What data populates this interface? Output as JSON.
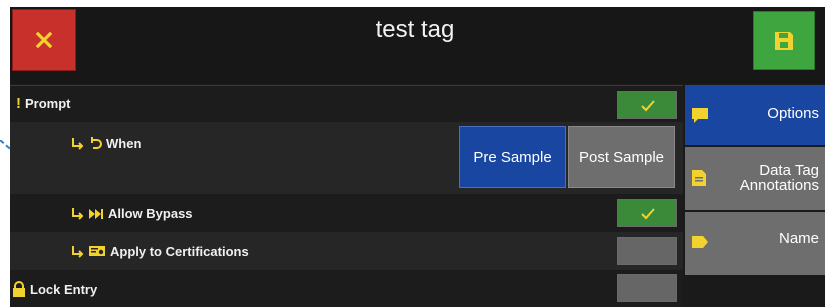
{
  "header": {
    "title": "test tag"
  },
  "rows": {
    "prompt_label": "Prompt",
    "when_label": "When",
    "allow_bypass_label": "Allow Bypass",
    "apply_cert_label": "Apply to Certifications",
    "lock_entry_label": "Lock Entry"
  },
  "when_options": {
    "pre": "Pre Sample",
    "post": "Post Sample",
    "selected": "Pre Sample"
  },
  "toggles": {
    "prompt": true,
    "allow_bypass": true,
    "apply_to_certifications": false,
    "lock_entry": false
  },
  "side_panel": {
    "options": "Options",
    "data_tag_line1": "Data Tag",
    "data_tag_line2": "Annotations",
    "name": "Name"
  },
  "colors": {
    "accent_yellow": "#f2d22e",
    "selected_blue": "#1846a0",
    "check_green": "#3a8a3a",
    "close_red": "#c8302c",
    "save_green": "#3fa63f"
  },
  "icons": [
    "close-icon",
    "save-icon",
    "exclamation-icon",
    "sub-arrow-icon",
    "undo-icon",
    "fast-forward-icon",
    "certificate-icon",
    "lock-icon",
    "check-icon",
    "speech-bubble-icon",
    "document-icon",
    "tag-icon"
  ]
}
